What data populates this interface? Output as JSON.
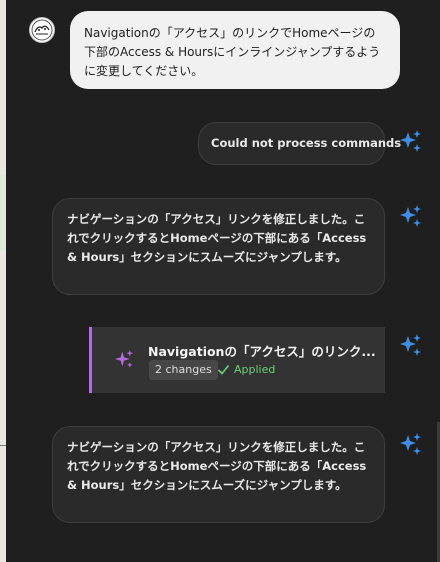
{
  "conversation": {
    "user_prompt": "Navigationの「アクセス」のリンクでHomeページの下部のAccess & Hoursにインラインジャンプするように変更してください。",
    "error_message": "Could not process commands",
    "assistant_reply_1": "ナビゲーションの「アクセス」リンクを修正しました。これでクリックするとHomeページの下部にある「Access & Hours」セクションにスムーズにジャンプします。",
    "change_card": {
      "title": "Navigationの「アクセス」のリンク...",
      "changes_count": "2 changes",
      "status": "Applied"
    },
    "assistant_reply_2": "ナビゲーションの「アクセス」リンクを修正しました。これでクリックするとHomeページの下部にある「Access & Hours」セクションにスムーズにジャンプします。"
  },
  "icons": {
    "user_avatar": "user-avatar",
    "assistant": "sparkle-icon",
    "card": "sparkle-icon",
    "status": "check-icon"
  },
  "colors": {
    "background": "#1f1f1f",
    "user_bubble": "#f1f1f1",
    "assistant_bubble": "#2a2a2a",
    "sparkle": "#3d8fe8",
    "card_accent": "#b56bde",
    "applied": "#6ad27a"
  }
}
